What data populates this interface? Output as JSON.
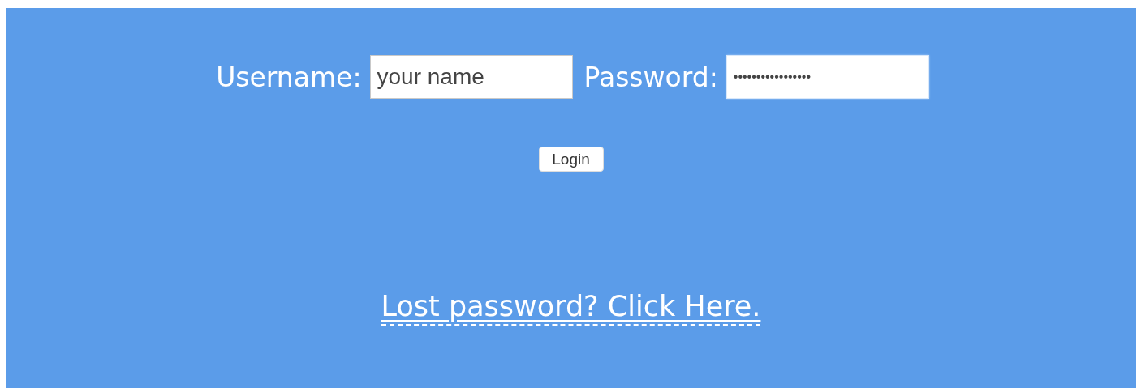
{
  "form": {
    "fields": [
      {
        "label": "Username:",
        "value": "your name"
      },
      {
        "label": "Password:",
        "value": "•••••••••••••••••"
      }
    ],
    "button": "Login",
    "link": "Lost password? Click Here."
  }
}
